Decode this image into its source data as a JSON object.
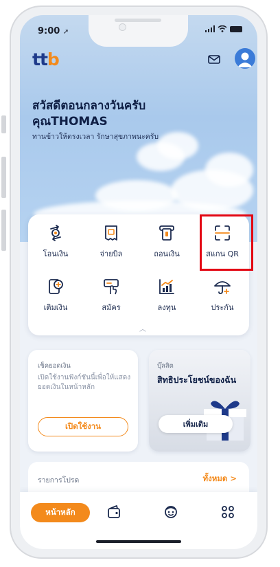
{
  "status": {
    "time": "9:00"
  },
  "header": {
    "logo_main": "tt",
    "logo_accent": "b"
  },
  "greeting": {
    "line1": "สวัสดีตอนกลางวันครับ",
    "line2": "คุณTHOMAS",
    "line3": "ทานข้าวให้ตรงเวลา รักษาสุขภาพนะครับ"
  },
  "menu": {
    "items": [
      {
        "label": "โอนเงิน",
        "icon": "transfer-icon"
      },
      {
        "label": "จ่ายบิล",
        "icon": "bill-icon"
      },
      {
        "label": "ถอนเงิน",
        "icon": "withdraw-icon"
      },
      {
        "label": "สแกน QR",
        "icon": "scan-qr-icon"
      },
      {
        "label": "เติมเงิน",
        "icon": "topup-icon"
      },
      {
        "label": "สมัคร",
        "icon": "apply-icon"
      },
      {
        "label": "ลงทุน",
        "icon": "invest-icon"
      },
      {
        "label": "ประกัน",
        "icon": "insurance-icon"
      }
    ]
  },
  "balance_card": {
    "title": "เช็คยอดเงิน",
    "desc": "เปิดใช้งานฟังก์ชันนี้เพื่อให้แสดงยอดเงินในหน้าหลัก",
    "button": "เปิดใช้งาน"
  },
  "benefit_card": {
    "title": "บุ๊ลสิต",
    "heading": "สิทธิประโยชน์ของฉัน",
    "button": "เพิ่มเติม"
  },
  "favorites": {
    "label": "รายการโปรด",
    "view_all": "ทั้งหมด >"
  },
  "bottom_nav": {
    "home": "หน้าหลัก"
  },
  "colors": {
    "brand_blue": "#1e3a8a",
    "brand_orange": "#f38a1c",
    "highlight_red": "#e30613"
  }
}
